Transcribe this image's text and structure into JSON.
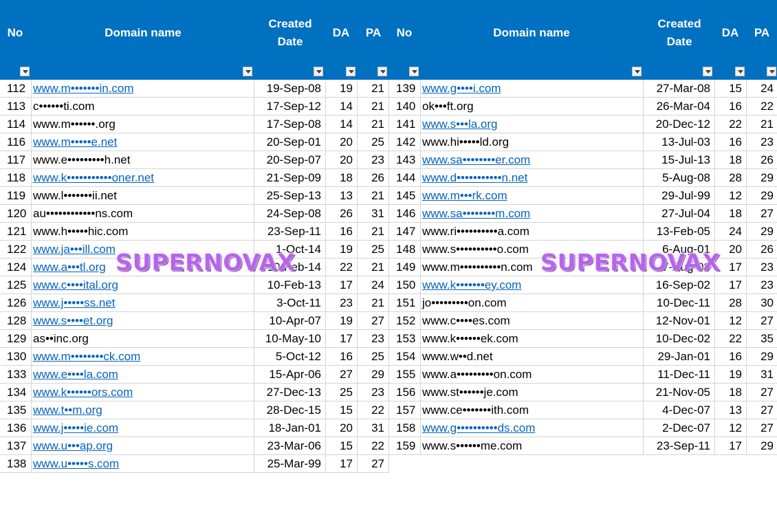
{
  "headers": {
    "no": "No",
    "domain": "Domain name",
    "created": "Created\nDate",
    "da": "DA",
    "pa": "PA"
  },
  "watermark": "SUPERNOVAX",
  "colors": {
    "header_bg": "#0070c0",
    "link": "#0563c1",
    "watermark": "#b565e8"
  },
  "left_rows": [
    {
      "no": "112",
      "domain": "www.m•••••••in.com",
      "date": "19-Sep-08",
      "da": "19",
      "pa": "21",
      "link": true
    },
    {
      "no": "113",
      "domain": "c••••••ti.com",
      "date": "17-Sep-12",
      "da": "14",
      "pa": "21",
      "link": false
    },
    {
      "no": "114",
      "domain": "www.m••••••.org",
      "date": "17-Sep-08",
      "da": "14",
      "pa": "21",
      "link": false
    },
    {
      "no": "116",
      "domain": "www.m•••••e.net",
      "date": "20-Sep-01",
      "da": "20",
      "pa": "25",
      "link": true
    },
    {
      "no": "117",
      "domain": "www.e•••••••••h.net",
      "date": "20-Sep-07",
      "da": "20",
      "pa": "23",
      "link": false
    },
    {
      "no": "118",
      "domain": "www.k•••••••••••oner.net",
      "date": "21-Sep-09",
      "da": "18",
      "pa": "26",
      "link": true
    },
    {
      "no": "119",
      "domain": "www.l•••••••ii.net",
      "date": "25-Sep-13",
      "da": "13",
      "pa": "21",
      "link": false
    },
    {
      "no": "120",
      "domain": "au••••••••••••ns.com",
      "date": "24-Sep-08",
      "da": "26",
      "pa": "31",
      "link": false
    },
    {
      "no": "121",
      "domain": "www.h•••••hic.com",
      "date": "23-Sep-11",
      "da": "16",
      "pa": "21",
      "link": false
    },
    {
      "no": "122",
      "domain": "www.ja•••ill.com",
      "date": "1-Oct-14",
      "da": "19",
      "pa": "25",
      "link": true
    },
    {
      "no": "124",
      "domain": "www.a•••tl.org",
      "date": "10-Feb-14",
      "da": "22",
      "pa": "21",
      "link": true
    },
    {
      "no": "125",
      "domain": "www.c••••ital.org",
      "date": "10-Feb-13",
      "da": "17",
      "pa": "24",
      "link": true
    },
    {
      "no": "126",
      "domain": "www.j•••••ss.net",
      "date": "3-Oct-11",
      "da": "23",
      "pa": "21",
      "link": true
    },
    {
      "no": "128",
      "domain": "www.s••••et.org",
      "date": "10-Apr-07",
      "da": "19",
      "pa": "27",
      "link": true
    },
    {
      "no": "129",
      "domain": "as••inc.org",
      "date": "10-May-10",
      "da": "17",
      "pa": "23",
      "link": false
    },
    {
      "no": "130",
      "domain": "www.m••••••••ck.com",
      "date": "5-Oct-12",
      "da": "16",
      "pa": "25",
      "link": true
    },
    {
      "no": "133",
      "domain": "www.e••••la.com",
      "date": "15-Apr-06",
      "da": "27",
      "pa": "29",
      "link": true
    },
    {
      "no": "134",
      "domain": "www.k••••••ors.com",
      "date": "27-Dec-13",
      "da": "25",
      "pa": "23",
      "link": true
    },
    {
      "no": "135",
      "domain": "www.t••m.org",
      "date": "28-Dec-15",
      "da": "15",
      "pa": "22",
      "link": true
    },
    {
      "no": "136",
      "domain": "www.j•••••ie.com",
      "date": "18-Jan-01",
      "da": "20",
      "pa": "31",
      "link": true
    },
    {
      "no": "137",
      "domain": "www.u•••ap.org",
      "date": "23-Mar-06",
      "da": "15",
      "pa": "22",
      "link": true
    },
    {
      "no": "138",
      "domain": "www.u•••••s.com",
      "date": "25-Mar-99",
      "da": "17",
      "pa": "27",
      "link": true
    }
  ],
  "right_rows": [
    {
      "no": "139",
      "domain": "www.g••••i.com",
      "date": "27-Mar-08",
      "da": "15",
      "pa": "24",
      "link": true
    },
    {
      "no": "140",
      "domain": "ok•••ft.org",
      "date": "26-Mar-04",
      "da": "16",
      "pa": "22",
      "link": false
    },
    {
      "no": "141",
      "domain": "www.s•••la.org",
      "date": "20-Dec-12",
      "da": "22",
      "pa": "21",
      "link": true
    },
    {
      "no": "142",
      "domain": "www.hi•••••ld.org",
      "date": "13-Jul-03",
      "da": "16",
      "pa": "23",
      "link": false
    },
    {
      "no": "143",
      "domain": "www.sa••••••••er.com",
      "date": "15-Jul-13",
      "da": "18",
      "pa": "26",
      "link": true
    },
    {
      "no": "144",
      "domain": "www.d•••••••••••n.net",
      "date": "5-Aug-08",
      "da": "28",
      "pa": "29",
      "link": true
    },
    {
      "no": "145",
      "domain": "www.m•••rk.com",
      "date": "29-Jul-99",
      "da": "12",
      "pa": "29",
      "link": true
    },
    {
      "no": "146",
      "domain": "www.sa••••••••m.com",
      "date": "27-Jul-04",
      "da": "18",
      "pa": "27",
      "link": true
    },
    {
      "no": "147",
      "domain": "www.ri••••••••••a.com",
      "date": "13-Feb-05",
      "da": "24",
      "pa": "29",
      "link": false
    },
    {
      "no": "148",
      "domain": "www.s••••••••••o.com",
      "date": "6-Aug-01",
      "da": "20",
      "pa": "26",
      "link": false
    },
    {
      "no": "149",
      "domain": "www.m••••••••••n.com",
      "date": "7-Aug-08",
      "da": "17",
      "pa": "23",
      "link": false
    },
    {
      "no": "150",
      "domain": "www.k•••••••ey.com",
      "date": "16-Sep-02",
      "da": "17",
      "pa": "23",
      "link": true
    },
    {
      "no": "151",
      "domain": "jo•••••••••on.com",
      "date": "10-Dec-11",
      "da": "28",
      "pa": "30",
      "link": false
    },
    {
      "no": "152",
      "domain": "www.c••••es.com",
      "date": "12-Nov-01",
      "da": "12",
      "pa": "27",
      "link": false
    },
    {
      "no": "153",
      "domain": "www.k••••••ek.com",
      "date": "10-Dec-02",
      "da": "22",
      "pa": "35",
      "link": false
    },
    {
      "no": "154",
      "domain": "www.w••d.net",
      "date": "29-Jan-01",
      "da": "16",
      "pa": "29",
      "link": false
    },
    {
      "no": "155",
      "domain": "www.a•••••••••on.com",
      "date": "11-Dec-11",
      "da": "19",
      "pa": "31",
      "link": false
    },
    {
      "no": "156",
      "domain": "www.st••••••je.com",
      "date": "21-Nov-05",
      "da": "18",
      "pa": "27",
      "link": false
    },
    {
      "no": "157",
      "domain": "www.ce•••••••ith.com",
      "date": "4-Dec-07",
      "da": "13",
      "pa": "27",
      "link": false
    },
    {
      "no": "158",
      "domain": "www.g••••••••••ds.com",
      "date": "2-Dec-07",
      "da": "12",
      "pa": "27",
      "link": true
    },
    {
      "no": "159",
      "domain": "www.s••••••me.com",
      "date": "23-Sep-11",
      "da": "17",
      "pa": "29",
      "link": false
    }
  ]
}
